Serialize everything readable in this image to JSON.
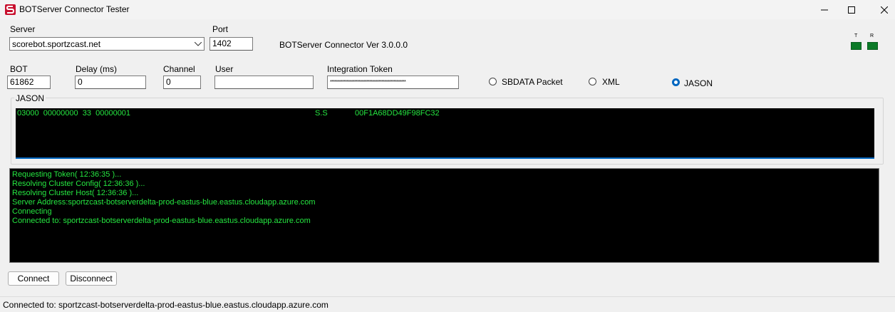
{
  "window": {
    "title": "BOTServer Connector Tester",
    "minimize": "—",
    "maximize": "☐",
    "close": "✕"
  },
  "server": {
    "label": "Server",
    "value": "scorebot.sportzcast.net"
  },
  "port": {
    "label": "Port",
    "value": "1402"
  },
  "version": "BOTServer Connector Ver 3.0.0.0",
  "indicators": {
    "t_label": "T",
    "r_label": "R",
    "color": "#0b7a27"
  },
  "bot": {
    "label": "BOT",
    "value": "61862"
  },
  "delay": {
    "label": "Delay (ms)",
    "value": "0"
  },
  "channel": {
    "label": "Channel",
    "value": "0"
  },
  "user": {
    "label": "User",
    "value": ""
  },
  "token": {
    "label": "Integration Token",
    "value": "**************************************************"
  },
  "format": {
    "options": [
      "SBDATA Packet",
      "XML",
      "JASON"
    ],
    "selected": "JASON"
  },
  "data_panel": {
    "title": "JASON",
    "line_left": "03000  00000000  33  00000001",
    "line_mid": "S.S",
    "line_right": "00F1A68DD49F98FC32"
  },
  "log": [
    "Requesting Token( 12:36:35 )...",
    "Resolving Cluster Config( 12:36:36 )...",
    "Resolving Cluster Host( 12:36:36 )...",
    "Server Address:sportzcast-botserverdelta-prod-eastus-blue.eastus.cloudapp.azure.com",
    "Connecting",
    "Connected to: sportzcast-botserverdelta-prod-eastus-blue.eastus.cloudapp.azure.com"
  ],
  "buttons": {
    "connect": "Connect",
    "disconnect": "Disconnect"
  },
  "status": "Connected to: sportzcast-botserverdelta-prod-eastus-blue.eastus.cloudapp.azure.com",
  "colors": {
    "console_text": "#25e640",
    "console_bg": "#000000",
    "accent": "#0067c0"
  }
}
